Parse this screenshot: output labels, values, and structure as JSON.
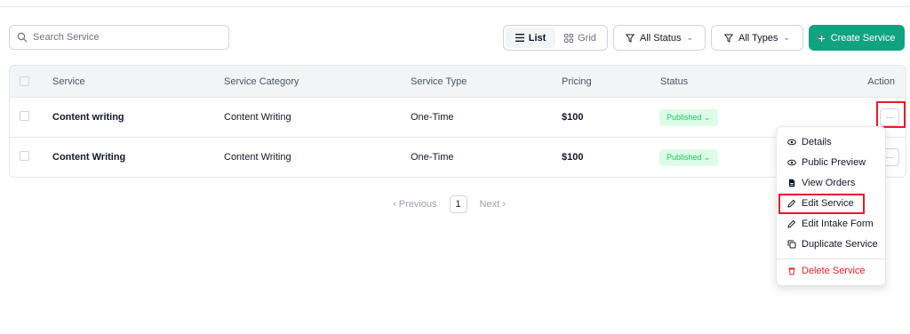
{
  "search": {
    "placeholder": "Search Service"
  },
  "view_toggle": {
    "list_label": "List",
    "grid_label": "Grid",
    "active": "List"
  },
  "filters": {
    "status_label": "All Status",
    "types_label": "All Types"
  },
  "create_button": {
    "label": "Create Service",
    "color": "#10a37f"
  },
  "table": {
    "headers": {
      "service": "Service",
      "category": "Service Category",
      "type": "Service Type",
      "pricing": "Pricing",
      "status": "Status",
      "action": "Action"
    },
    "rows": [
      {
        "service": "Content writing",
        "category": "Content Writing",
        "type": "One-Time",
        "pricing": "$100",
        "status": "Published",
        "action": "···"
      },
      {
        "service": "Content Writing",
        "category": "Content Writing",
        "type": "One-Time",
        "pricing": "$100",
        "status": "Published",
        "action": "···"
      }
    ]
  },
  "pagination": {
    "previous": "Previous",
    "current_page": "1",
    "next": "Next"
  },
  "action_menu": {
    "items": [
      {
        "label": "Details",
        "icon": "eye-icon"
      },
      {
        "label": "Public Preview",
        "icon": "eye-icon"
      },
      {
        "label": "View Orders",
        "icon": "document-icon"
      },
      {
        "label": "Edit Service",
        "icon": "edit-icon"
      },
      {
        "label": "Edit Intake Form",
        "icon": "edit-icon"
      },
      {
        "label": "Duplicate Service",
        "icon": "copy-icon"
      },
      {
        "label": "Delete Service",
        "icon": "trash-icon"
      }
    ]
  },
  "colors": {
    "accent": "#10a37f",
    "highlight": "#e11d2a",
    "badge_bg": "#dcfce7",
    "badge_text": "#22c55e",
    "danger": "#dc2626"
  }
}
